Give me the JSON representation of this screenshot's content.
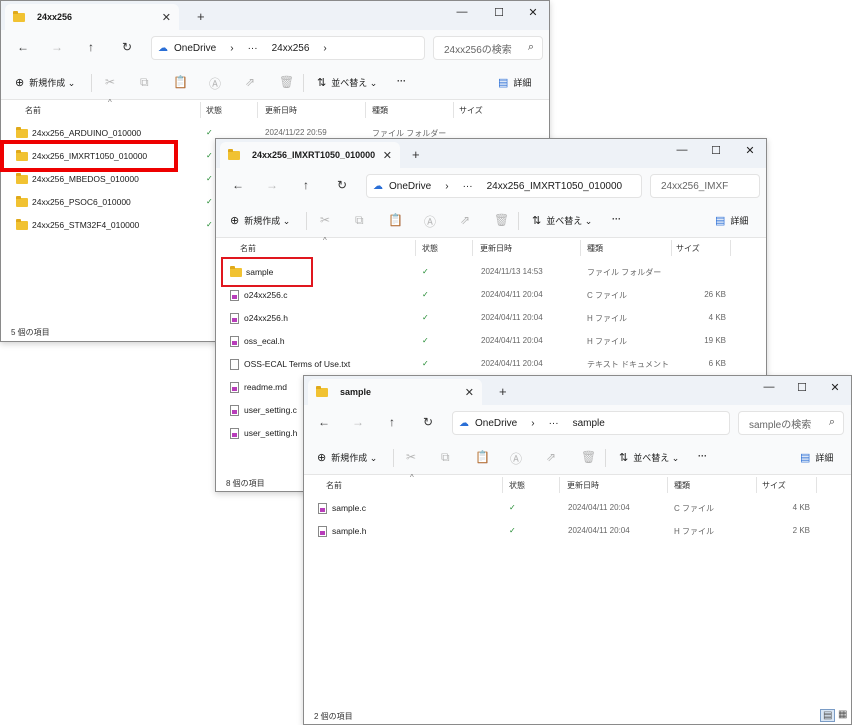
{
  "windows": {
    "w1": {
      "tab_title": "24xx256",
      "address": {
        "root": "OneDrive",
        "ellipsis": "···",
        "current": "24xx256"
      },
      "search_placeholder": "24xx256の検索",
      "new_label": "新規作成",
      "sort_label": "並べ替え",
      "details_label": "詳細",
      "more_label": "···",
      "columns": {
        "name": "名前",
        "status": "状態",
        "modified": "更新日時",
        "type": "種類",
        "size": "サイズ"
      },
      "rows": [
        {
          "name": "24xx256_ARDUINO_010000",
          "modified": "2024/11/22 20:59",
          "type": "ファイル フォルダー",
          "size": ""
        },
        {
          "name": "24xx256_IMXRT1050_010000"
        },
        {
          "name": "24xx256_MBEDOS_010000"
        },
        {
          "name": "24xx256_PSOC6_010000"
        },
        {
          "name": "24xx256_STM32F4_010000"
        }
      ],
      "status_text": "5 個の項目"
    },
    "w2": {
      "tab_title": "24xx256_IMXRT1050_010000",
      "address": {
        "root": "OneDrive",
        "ellipsis": "···",
        "current": "24xx256_IMXRT1050_010000"
      },
      "search_placeholder": "24xx256_IMXF",
      "new_label": "新規作成",
      "sort_label": "並べ替え",
      "details_label": "詳細",
      "more_label": "···",
      "columns": {
        "name": "名前",
        "status": "状態",
        "modified": "更新日時",
        "type": "種類",
        "size": "サイズ"
      },
      "rows": [
        {
          "name": "sample",
          "modified": "2024/11/13 14:53",
          "type": "ファイル フォルダー",
          "size": ""
        },
        {
          "name": "o24xx256.c",
          "modified": "2024/04/11 20:04",
          "type": "C ファイル",
          "size": "26 KB"
        },
        {
          "name": "o24xx256.h",
          "modified": "2024/04/11 20:04",
          "type": "H ファイル",
          "size": "4 KB"
        },
        {
          "name": "oss_ecal.h",
          "modified": "2024/04/11 20:04",
          "type": "H ファイル",
          "size": "19 KB"
        },
        {
          "name": "OSS-ECAL Terms of Use.txt",
          "modified": "2024/04/11 20:04",
          "type": "テキスト ドキュメント",
          "size": "6 KB"
        },
        {
          "name": "readme.md"
        },
        {
          "name": "user_setting.c"
        },
        {
          "name": "user_setting.h"
        }
      ],
      "status_text": "8 個の項目"
    },
    "w3": {
      "tab_title": "sample",
      "address": {
        "root": "OneDrive",
        "ellipsis": "···",
        "current": "sample"
      },
      "search_placeholder": "sampleの検索",
      "new_label": "新規作成",
      "sort_label": "並べ替え",
      "details_label": "詳細",
      "more_label": "···",
      "columns": {
        "name": "名前",
        "status": "状態",
        "modified": "更新日時",
        "type": "種類",
        "size": "サイズ"
      },
      "rows": [
        {
          "name": "sample.c",
          "modified": "2024/04/11 20:04",
          "type": "C ファイル",
          "size": "4 KB"
        },
        {
          "name": "sample.h",
          "modified": "2024/04/11 20:04",
          "type": "H ファイル",
          "size": "2 KB"
        }
      ],
      "status_text": "2 個の項目"
    }
  },
  "icons": {
    "close": "✕",
    "minimize": "—",
    "maximize": "☐",
    "plus": "+",
    "back": "←",
    "forward": "→",
    "up": "↑",
    "refresh": "↻",
    "chevron_right": "›",
    "search": "⌕",
    "new": "⊕",
    "cut": "✂",
    "copy": "⧉",
    "paste": "📋",
    "rename": "Ⓐ",
    "share": "⇗",
    "delete": "🗑",
    "sort": "⇅",
    "details": "▤",
    "check": "✓",
    "caret_up": "^",
    "dropdown": "⌄"
  }
}
